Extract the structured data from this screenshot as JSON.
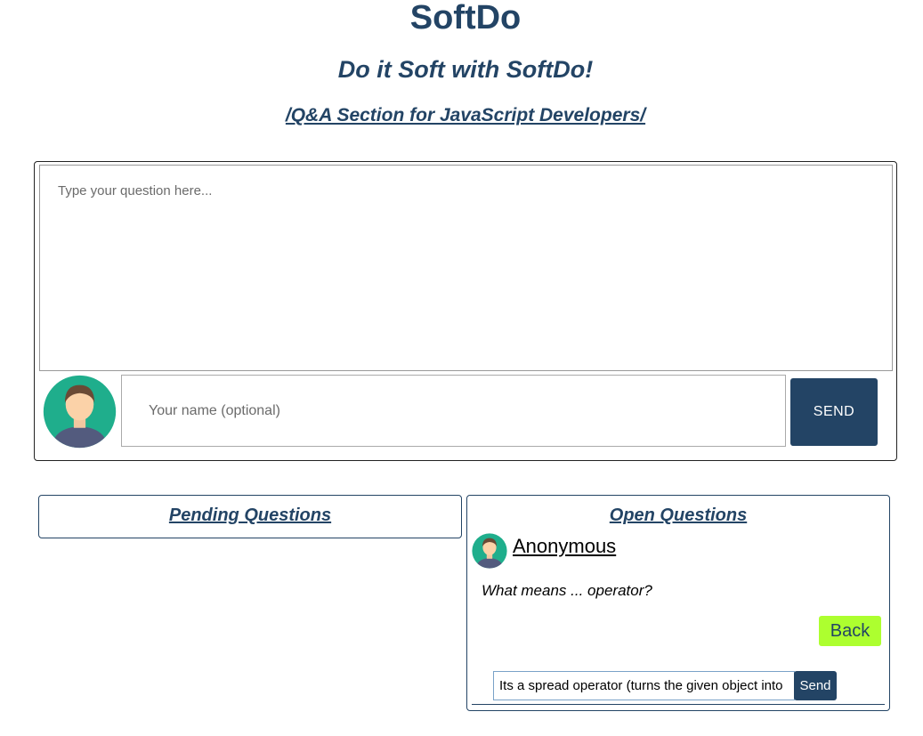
{
  "header": {
    "title": "SoftDo",
    "subtitle": "Do it Soft with SoftDo!",
    "section_link": "/Q&A Section for JavaScript Developers/"
  },
  "ask_form": {
    "question_placeholder": "Type your question here...",
    "name_placeholder": "Your name (optional)",
    "send_label": "SEND",
    "avatar_icon": "user-avatar-icon"
  },
  "panels": {
    "pending": {
      "heading": "Pending Questions"
    },
    "open": {
      "heading": "Open Questions",
      "question": {
        "author": "Anonymous",
        "text": "What means ... operator?",
        "back_label": "Back",
        "answer_value": "Its a spread operator (turns the given object into",
        "send_label": "Send"
      }
    }
  },
  "colors": {
    "brand": "#234465",
    "back_button": "#adff2f",
    "avatar_bg": "#1fae8c"
  }
}
